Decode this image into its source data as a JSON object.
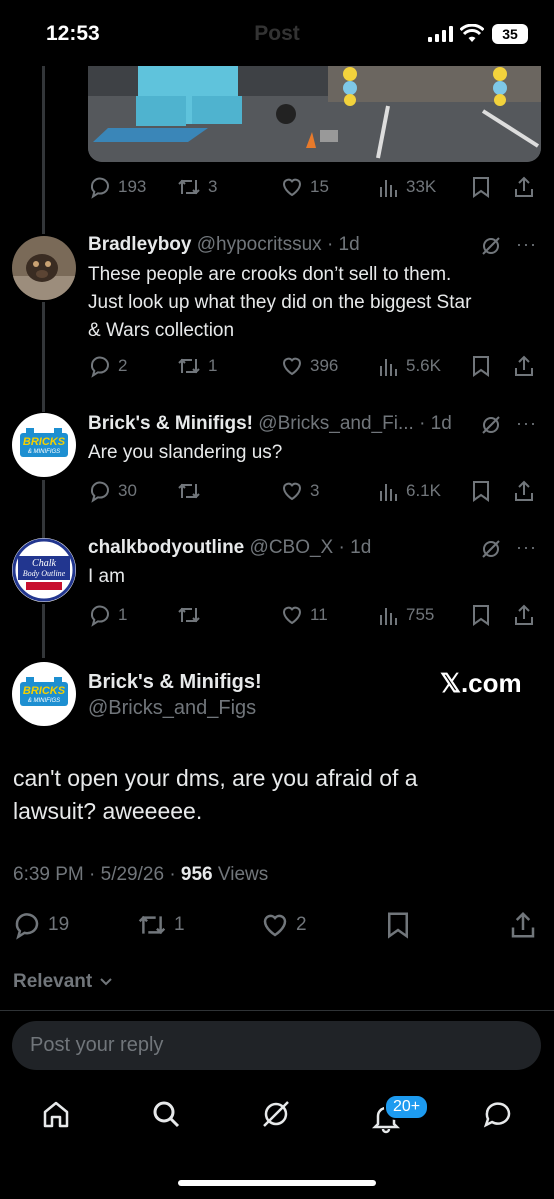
{
  "status_bar": {
    "time": "12:53",
    "faded_title": "Post",
    "battery": "35"
  },
  "top_post_actions": {
    "replies": "193",
    "reposts": "3",
    "likes": "15",
    "views": "33K"
  },
  "replies": [
    {
      "name": "Bradleyboy",
      "handle": "@hypocritssux",
      "time": "· 1d",
      "lines": [
        "These people are crooks don’t sell to them.",
        "Just look up what they did on the biggest Star",
        "& Wars collection"
      ],
      "actions": {
        "replies": "2",
        "reposts": "1",
        "likes": "396",
        "views": "5.6K"
      }
    },
    {
      "name": "Brick's & Minifigs!",
      "handle": "@Bricks_and_Fi...",
      "time": "· 1d",
      "lines": [
        "Are you slandering us?"
      ],
      "actions": {
        "replies": "30",
        "reposts": "",
        "likes": "3",
        "views": "6.1K"
      }
    },
    {
      "name": "chalkbodyoutline",
      "handle": "@CBO_X",
      "time": "· 1d",
      "lines": [
        "I am"
      ],
      "actions": {
        "replies": "1",
        "reposts": "",
        "likes": "11",
        "views": "755"
      }
    }
  ],
  "avatar_text": {
    "bricks_line1": "BRICKS",
    "bricks_line2": "& MINIFIGS",
    "chalk_line1": "Chalk",
    "chalk_line2": "Body Outline"
  },
  "main_post": {
    "name": "Brick's & Minifigs!",
    "handle": "@Bricks_and_Figs",
    "watermark": "𝕏.com",
    "text_line1": "can't open your dms, are you afraid of a",
    "text_line2": "lawsuit? aweeeee.",
    "time_date": "6:39 PM · 5/29/26 · ",
    "views_count": "956",
    "views_label": " Views",
    "actions": {
      "replies": "19",
      "reposts": "1",
      "likes": "2"
    }
  },
  "sort": {
    "label": "Relevant"
  },
  "reply_placeholder": "Post your reply",
  "tabbar": {
    "notif_badge": "20+"
  },
  "colors": {
    "muted": "#71767b",
    "accent": "#1d9bf0"
  }
}
